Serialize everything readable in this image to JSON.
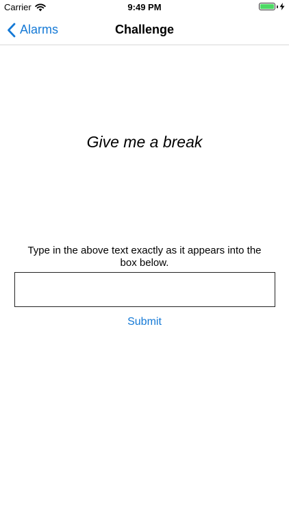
{
  "status_bar": {
    "carrier": "Carrier",
    "time": "9:49 PM",
    "battery_level": 1.0,
    "battery_color": "#4cd964",
    "icons": [
      "wifi-icon",
      "battery-icon",
      "charging-bolt-icon"
    ]
  },
  "nav": {
    "back_label": "Alarms",
    "back_icon": "chevron-left-icon",
    "title": "Challenge",
    "accent_color": "#1479d6"
  },
  "challenge": {
    "phrase": "Give me a break",
    "instructions": "Type in the above text exactly as it appears into the box below.",
    "input_value": "",
    "input_placeholder": "",
    "submit_label": "Submit"
  }
}
